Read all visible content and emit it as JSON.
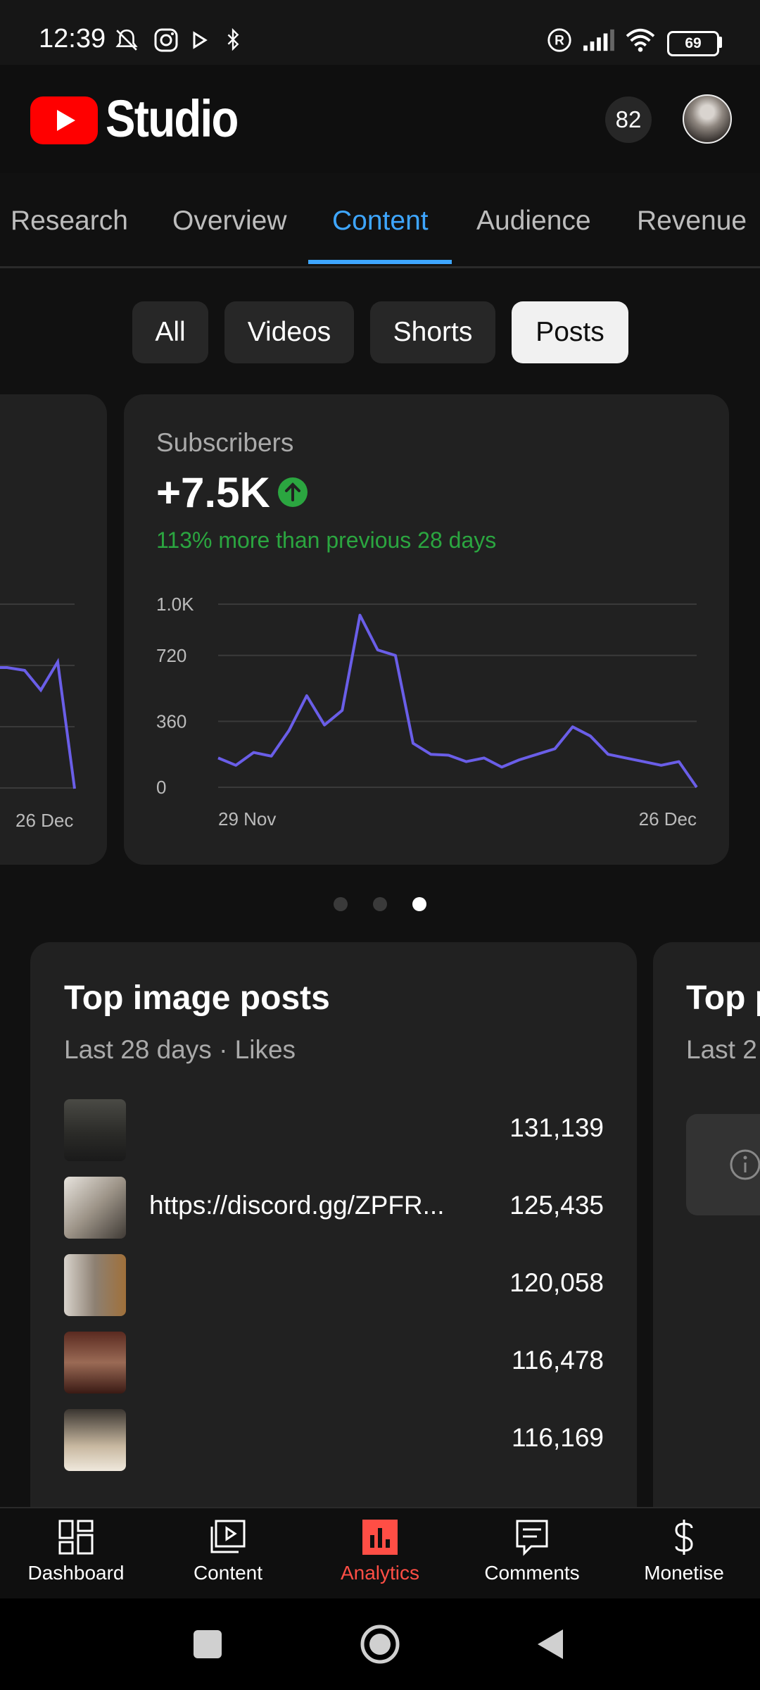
{
  "status_bar": {
    "time": "12:39",
    "battery": "69"
  },
  "header": {
    "app_name": "Studio",
    "notification_count": "82"
  },
  "tabs": [
    {
      "label": "Research"
    },
    {
      "label": "Overview"
    },
    {
      "label": "Content"
    },
    {
      "label": "Audience"
    },
    {
      "label": "Revenue"
    }
  ],
  "active_tab": "Content",
  "filter_chips": [
    {
      "label": "All"
    },
    {
      "label": "Videos"
    },
    {
      "label": "Shorts"
    },
    {
      "label": "Posts"
    }
  ],
  "selected_chip": "Posts",
  "left_card": {
    "x_end_label": "26 Dec"
  },
  "subscribers_card": {
    "title": "Subscribers",
    "value": "+7.5K",
    "change_text": "113% more than previous 28 days"
  },
  "chart_data": {
    "type": "line",
    "title": "",
    "xlabel": "",
    "ylabel": "",
    "x_tick_labels": [
      "29 Nov",
      "26 Dec"
    ],
    "y_tick_labels": [
      "1.0K",
      "720",
      "360",
      "0"
    ],
    "ylim": [
      0,
      1080
    ],
    "grid": true,
    "series": [
      {
        "color": "#6a5ee8",
        "values": [
          160,
          120,
          190,
          170,
          310,
          500,
          340,
          420,
          940,
          750,
          720,
          240,
          180,
          175,
          140,
          160,
          110,
          150,
          180,
          210,
          330,
          280,
          180,
          160,
          140,
          120,
          140,
          0
        ]
      }
    ]
  },
  "carousel": {
    "page_count": 3,
    "active_index": 2
  },
  "top_posts": {
    "title": "Top image posts",
    "subtitle": "Last 28 days · Likes",
    "items": [
      {
        "text": "",
        "value": "131,139"
      },
      {
        "text": "https://discord.gg/ZPFR...",
        "value": "125,435"
      },
      {
        "text": "",
        "value": "120,058"
      },
      {
        "text": "",
        "value": "116,478"
      },
      {
        "text": "",
        "value": "116,169"
      }
    ]
  },
  "right_card": {
    "title": "Top p",
    "subtitle": "Last 2"
  },
  "bottom_nav": [
    {
      "label": "Dashboard",
      "icon": "dashboard-icon"
    },
    {
      "label": "Content",
      "icon": "content-icon"
    },
    {
      "label": "Analytics",
      "icon": "analytics-icon"
    },
    {
      "label": "Comments",
      "icon": "comments-icon"
    },
    {
      "label": "Monetise",
      "icon": "monetise-icon"
    }
  ],
  "active_nav": "Analytics",
  "colors": {
    "accent": "#3ea6ff",
    "brand_red": "#ff0000",
    "positive": "#2ba640",
    "chart_line": "#6a5ee8",
    "nav_active": "#ff4e45"
  }
}
